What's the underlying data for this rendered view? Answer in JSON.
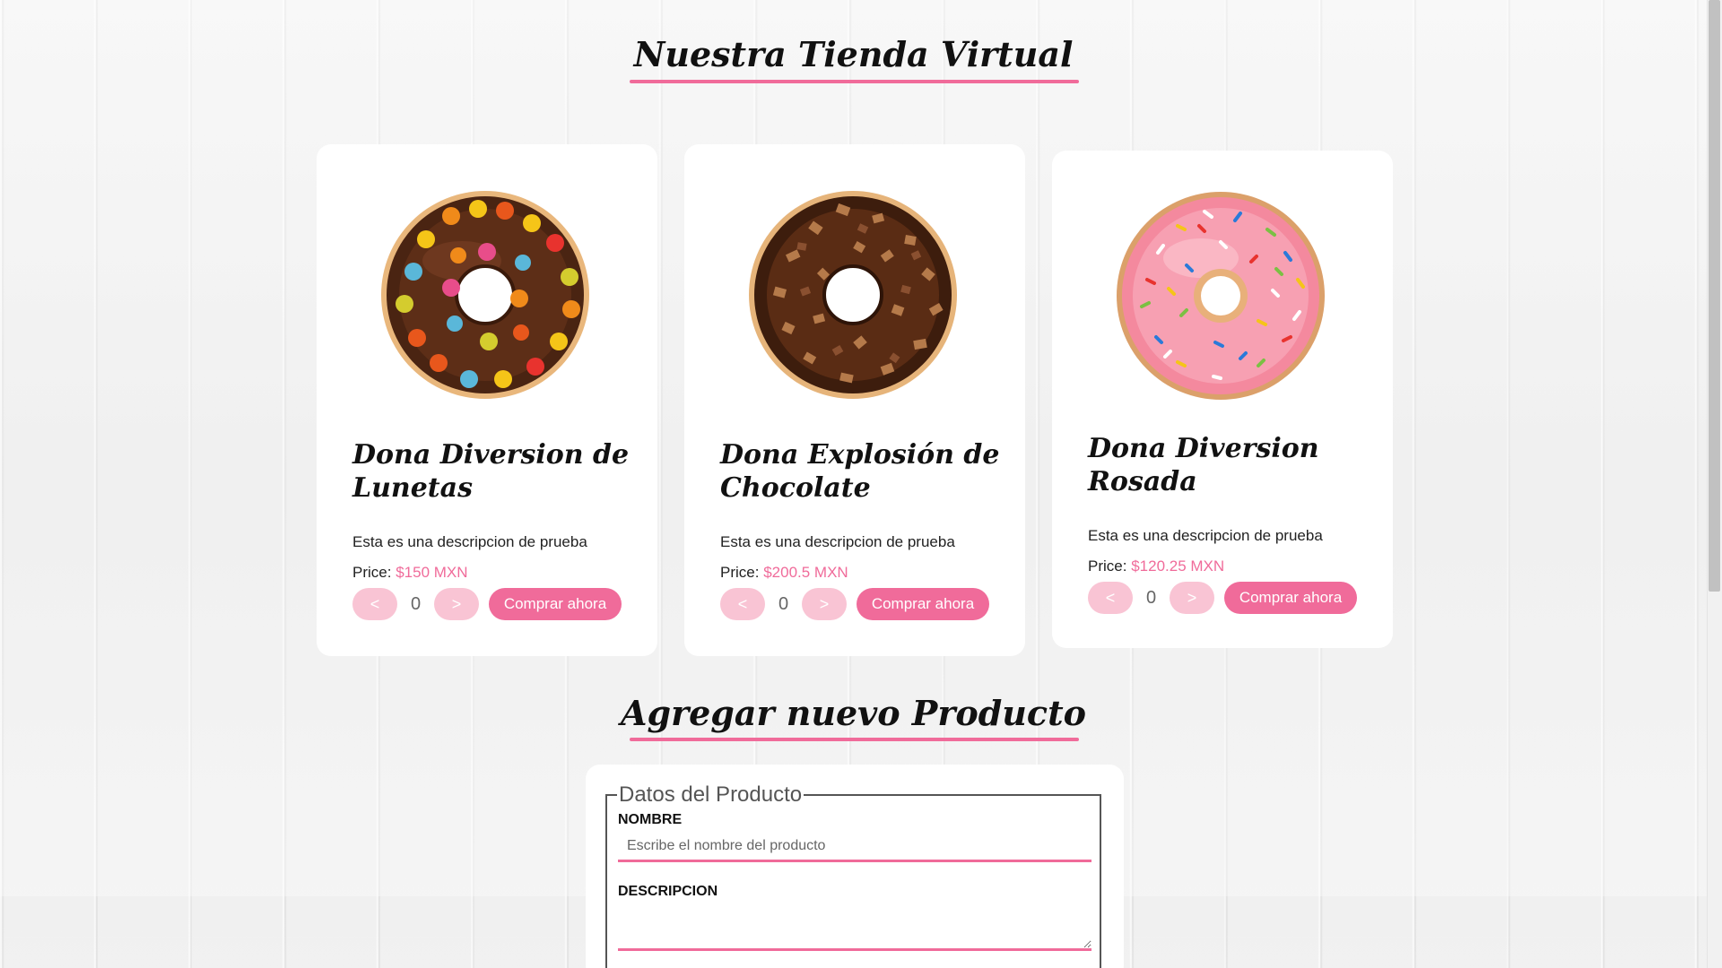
{
  "store": {
    "title": "Nuestra Tienda Virtual",
    "price_label": "Price:",
    "products": [
      {
        "name": "Dona Diversion de Lunetas",
        "description": "Esta es una descripcion de prueba",
        "price": "$150 MXN",
        "quantity": "0",
        "decrement_label": "<",
        "increment_label": ">",
        "buy_label": "Comprar ahora",
        "icon": "chocolate-donut-candy-icon"
      },
      {
        "name": "Dona Explosión de Chocolate",
        "description": "Esta es una descripcion de prueba",
        "price": "$200.5 MXN",
        "quantity": "0",
        "decrement_label": "<",
        "increment_label": ">",
        "buy_label": "Comprar ahora",
        "icon": "chocolate-crumble-donut-icon"
      },
      {
        "name": "Dona Diversion Rosada",
        "description": "Esta es una descripcion de prueba",
        "price": "$120.25 MXN",
        "quantity": "0",
        "decrement_label": "<",
        "increment_label": ">",
        "buy_label": "Comprar ahora",
        "icon": "pink-sprinkle-donut-icon"
      }
    ]
  },
  "add_product": {
    "title": "Agregar nuevo Producto",
    "legend": "Datos del Producto",
    "name_label": "NOMBRE",
    "name_placeholder": "Escribe el nombre del producto",
    "name_value": "",
    "description_label": "DESCRIPCION",
    "description_value": ""
  },
  "colors": {
    "accent": "#f06b9a",
    "accent_light": "#f9c4d4",
    "card_background": "#ffffff"
  }
}
